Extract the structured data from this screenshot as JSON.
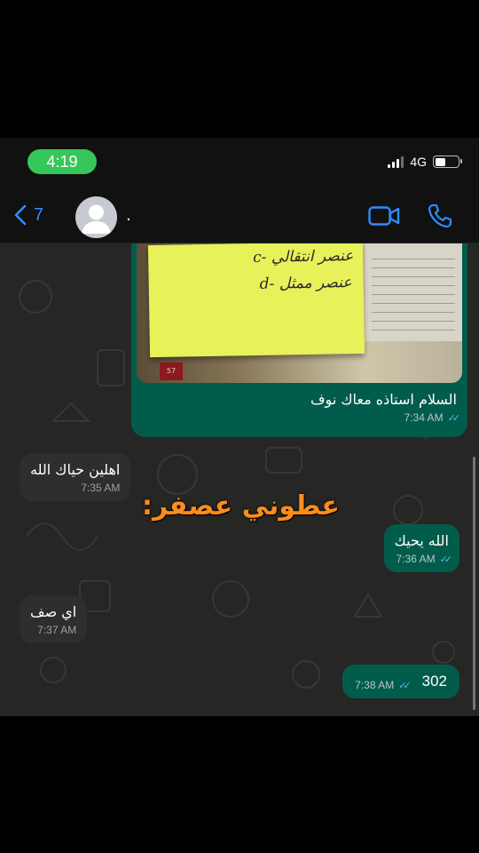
{
  "status_bar": {
    "time": "4:19",
    "network": "4G",
    "battery_level": 0.45,
    "pill_color": "#35c759"
  },
  "header": {
    "back_count": "7",
    "contact_name": ".",
    "icons": [
      "chevron-left-icon",
      "avatar",
      "video-call-icon",
      "phone-icon"
    ],
    "accent_color": "#2e8dfd"
  },
  "image_note": {
    "line_c": "c- عنصر انتقالي",
    "line_d": "d- عنصر ممثل",
    "book_page": "57"
  },
  "messages": [
    {
      "direction": "out",
      "text": "السلام استاذه معاك نوف",
      "time": "7:34 AM",
      "read": true
    },
    {
      "direction": "in",
      "text": "اهلين حياك الله",
      "time": "7:35 AM"
    },
    {
      "direction": "out",
      "text": "الله يحيك",
      "time": "7:36 AM",
      "read": true
    },
    {
      "direction": "in",
      "text": "اي صف",
      "time": "7:37 AM"
    },
    {
      "direction": "out",
      "text": "302",
      "time": "7:38 AM",
      "read": true
    }
  ],
  "overlay_caption": "عطوني عصفر:",
  "colors": {
    "outgoing_bubble": "#025c4b",
    "incoming_bubble": "#2e2e2e",
    "read_ticks": "#53bdeb",
    "caption": "#ff8c1a"
  }
}
